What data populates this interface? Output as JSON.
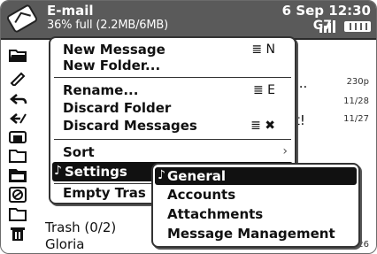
{
  "header": {
    "title": "E-mail",
    "storage": "36% full (2.2MB/6MB)",
    "date_time": "6 Sep 12:30",
    "signal_label": "G7"
  },
  "background_list": {
    "items": [
      {
        "text": "...",
        "time": "230p"
      },
      {
        "text": "",
        "time": "11/28"
      },
      {
        "text": "t!",
        "time": "11/27"
      }
    ],
    "trash_label": "Trash (0/2)",
    "trash_sender": "Gloria",
    "trash_time": "26"
  },
  "menu": {
    "items": [
      {
        "label": "New Message",
        "shortcut": "≣ N"
      },
      {
        "label": "New Folder...",
        "shortcut": ""
      },
      {
        "label": "Rename...",
        "shortcut": "≣ E"
      },
      {
        "label": "Discard Folder",
        "shortcut": ""
      },
      {
        "label": "Discard Messages",
        "shortcut": "≣ ✖"
      },
      {
        "label": "Sort",
        "shortcut": ""
      },
      {
        "label": "Settings",
        "shortcut": ""
      },
      {
        "label": "Empty Tras",
        "shortcut": ""
      }
    ],
    "selected_check": "♪"
  },
  "submenu": {
    "items": [
      {
        "label": "General"
      },
      {
        "label": "Accounts"
      },
      {
        "label": "Attachments"
      },
      {
        "label": "Message Management"
      }
    ],
    "selected_check": "♪"
  },
  "colors": {
    "titlebar": "#5a5a5a",
    "selection": "#111111"
  },
  "icons": [
    "mail-app-icon",
    "folder-open-icon",
    "pencil-icon",
    "reply-icon",
    "reply-all-icon",
    "printer-icon",
    "folder-icon",
    "folder-selected-icon",
    "no-entry-icon",
    "folder-small-icon",
    "trash-icon"
  ]
}
